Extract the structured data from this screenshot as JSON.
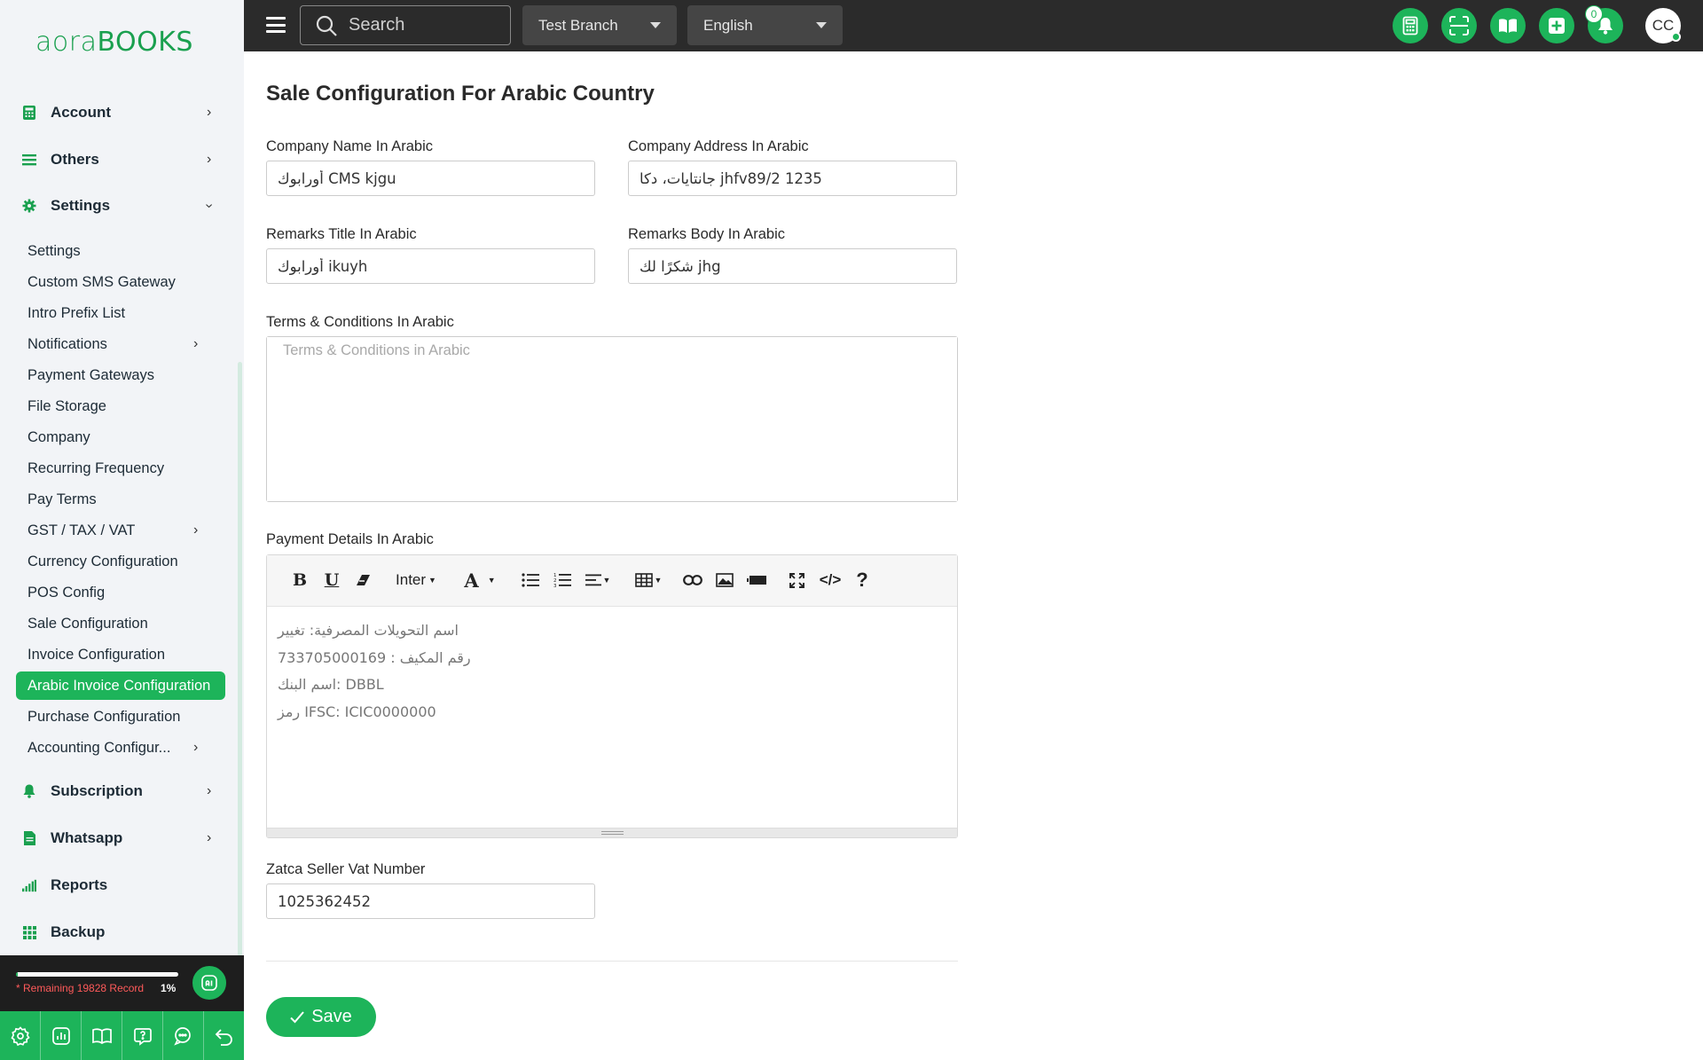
{
  "brand": {
    "logo_part1": "aora",
    "logo_part2": "BOOKS"
  },
  "sidebar": {
    "main_items": [
      {
        "label": "Account",
        "icon": "calculator-icon"
      },
      {
        "label": "Others",
        "icon": "list-icon"
      },
      {
        "label": "Settings",
        "icon": "gear-icon"
      },
      {
        "label": "Subscription",
        "icon": "bell-icon"
      },
      {
        "label": "Whatsapp",
        "icon": "document-icon"
      },
      {
        "label": "Reports",
        "icon": "bar-chart-icon"
      },
      {
        "label": "Backup",
        "icon": "grid-icon"
      }
    ],
    "settings_items": [
      {
        "label": "Settings"
      },
      {
        "label": "Custom SMS Gateway"
      },
      {
        "label": "Intro Prefix List"
      },
      {
        "label": "Notifications"
      },
      {
        "label": "Payment Gateways"
      },
      {
        "label": "File Storage"
      },
      {
        "label": "Company"
      },
      {
        "label": "Recurring Frequency"
      },
      {
        "label": "Pay Terms"
      },
      {
        "label": "GST / TAX / VAT"
      },
      {
        "label": "Currency Configuration"
      },
      {
        "label": "POS Config"
      },
      {
        "label": "Sale Configuration"
      },
      {
        "label": "Invoice Configuration"
      },
      {
        "label": "Arabic Invoice Configuration"
      },
      {
        "label": "Purchase Configuration"
      },
      {
        "label": "Accounting Configur..."
      }
    ],
    "footer": {
      "remaining_text": "* Remaining 19828 Record",
      "percent_text": "1%",
      "progress_fraction": 0.01
    }
  },
  "topbar": {
    "search_placeholder": "Search",
    "branch": "Test Branch",
    "language": "English",
    "notification_count": "0",
    "avatar_initials": "CC"
  },
  "page": {
    "title": "Sale Configuration For Arabic Country",
    "company_name": {
      "label": "Company Name In Arabic",
      "value": "أورابوك CMS kjgu"
    },
    "company_address": {
      "label": "Company Address In Arabic",
      "value": "جانتايات، دكا jhfv89/2 1235"
    },
    "remarks_title": {
      "label": "Remarks Title In Arabic",
      "value": "أورابوك ikuyh"
    },
    "remarks_body": {
      "label": "Remarks Body In Arabic",
      "value": "شكرًا لك jhg"
    },
    "terms": {
      "label": "Terms & Conditions In Arabic",
      "placeholder": "Terms & Conditions in Arabic",
      "value": ""
    },
    "payment_details": {
      "label": "Payment Details In Arabic",
      "font_name": "Inter",
      "lines": [
        "اسم التحويلات المصرفية: تغيير",
        "رقم المكيف : 733705000169",
        "اسم البنك: DBBL",
        "رمز IFSC: ICIC0000000"
      ]
    },
    "zatca": {
      "label": "Zatca Seller Vat Number",
      "value": "1025362452"
    },
    "save_label": "Save"
  },
  "colors": {
    "accent": "#1db45a",
    "topbar": "#2b2b2b",
    "sidebar": "#f2f4f7"
  }
}
